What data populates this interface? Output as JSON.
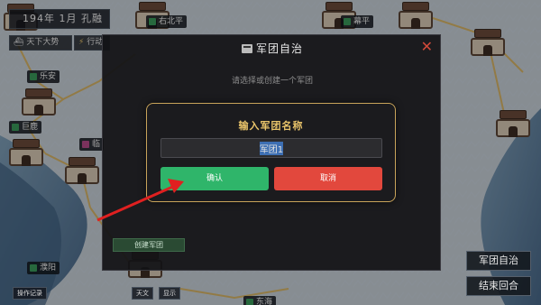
{
  "hud": {
    "date": "194年 1月 孔融",
    "resource_1": "天下大势",
    "resource_2": "行动"
  },
  "map": {
    "city_labels": [
      {
        "name": "右北平",
        "flag": "#3a9a5a"
      },
      {
        "name": "幕平",
        "flag": "#3a9a5a"
      },
      {
        "name": "乐安",
        "flag": "#3a9a5a"
      },
      {
        "name": "巨鹿",
        "flag": "#3a9a5a"
      },
      {
        "name": "临",
        "flag": "#b54a8a"
      },
      {
        "name": "濮阳",
        "flag": "#3a9a5a"
      },
      {
        "name": "东海",
        "flag": "#3a9a5a"
      }
    ]
  },
  "panel": {
    "title": "军团自治",
    "close": "✕",
    "subtitle": "请选择或创建一个军团",
    "create_button": "创建军团"
  },
  "dialog": {
    "title": "输入军团名称",
    "input_value": "军团1",
    "confirm_label": "确认",
    "cancel_label": "取消"
  },
  "right_buttons": {
    "autonomy": "军团自治",
    "end_turn": "结束回合"
  },
  "bottom_bar": {
    "log": "操作记录",
    "b2": "天文",
    "b3": "显示"
  },
  "colors": {
    "accent_gold": "#c8a35a",
    "confirm": "#2fb56a",
    "cancel": "#e2483d",
    "arrow": "#e02020"
  },
  "icons": [
    "ship-icon",
    "lightning-icon",
    "legion-icon",
    "close-icon",
    "red-arrow"
  ]
}
